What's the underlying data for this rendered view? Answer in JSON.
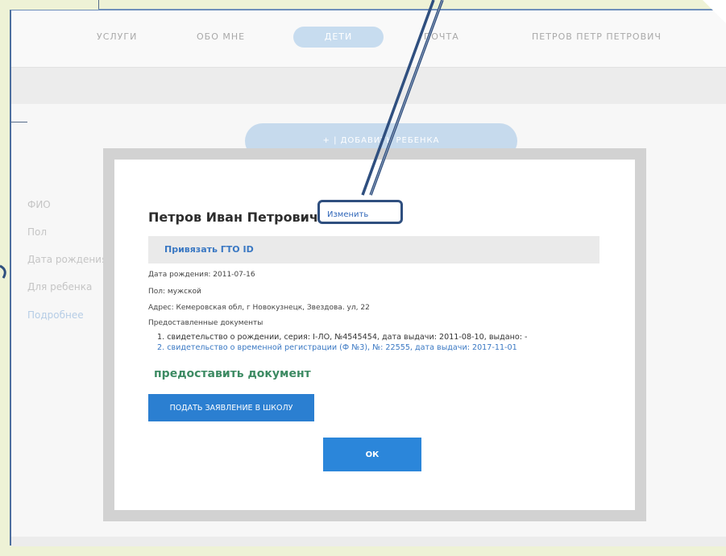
{
  "nav": {
    "items": [
      {
        "label": "УСЛУГИ"
      },
      {
        "label": "ОБО МНЕ"
      },
      {
        "label": "ДЕТИ"
      },
      {
        "label": "ПОЧТА"
      },
      {
        "label": "ПЕТРОВ ПЕТР ПЕТРОВИЧ"
      }
    ]
  },
  "add_child": {
    "label": "+ | ДОБАВИТЬ РЕБЕНКА"
  },
  "left_panel": {
    "fio": "ФИО",
    "gender": "Пол",
    "birth": "Дата рождения",
    "for_child": "Для ребенка",
    "more": "Подробнее"
  },
  "modal": {
    "child_name": "Петров Иван Петрович",
    "edit_label": "Изменить",
    "gto_label": "Привязать ГТО ID",
    "birth_date": "Дата рождения: 2011-07-16",
    "gender": "Пол: мужской",
    "address": "Адрес: Кемеровская обл, г Новокузнецк, Звездова. ул, 22",
    "docs_title": "Предоставленные документы",
    "docs": [
      {
        "text": "1. свидетельство о рождении, серия: I-ЛО, №4545454, дата выдачи: 2011-08-10, выдано: -"
      },
      {
        "text": "2. свидетельство о временной регистрации (Ф №3), №: 22555, дата выдачи: 2017-11-01"
      }
    ],
    "provide_doc": "предоставить документ",
    "school_button": "ПОДАТЬ ЗАЯВЛЕНИЕ В ШКОЛУ",
    "ok_button": "ОК"
  },
  "colors": {
    "accent": "#2b86da",
    "link": "#3a78c3",
    "green_link": "#3d8b63",
    "annotation": "#2f4f7f"
  }
}
